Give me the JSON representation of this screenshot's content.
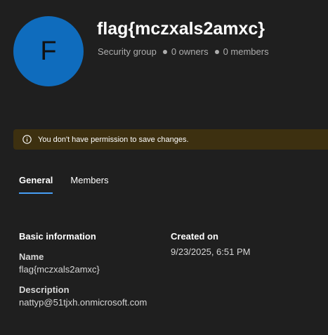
{
  "group": {
    "initial": "F",
    "name": "flag{mczxals2amxc}",
    "type": "Security group",
    "owners": "0 owners",
    "members": "0 members"
  },
  "banner": {
    "icon": "info-icon",
    "message": "You don't have permission to save changes."
  },
  "tabs": [
    {
      "label": "General",
      "active": true
    },
    {
      "label": "Members",
      "active": false
    }
  ],
  "basic_info": {
    "heading": "Basic information",
    "name_label": "Name",
    "name_value": "flag{mczxals2amxc}",
    "description_label": "Description",
    "description_value": "nattyp@51tjxh.onmicrosoft.com"
  },
  "created": {
    "heading": "Created on",
    "value": "9/23/2025, 6:51 PM"
  },
  "colors": {
    "avatar": "#0f6cbd",
    "banner_bg": "#3d3010",
    "tab_underline": "#479ef5",
    "background": "#1f1f1f"
  }
}
